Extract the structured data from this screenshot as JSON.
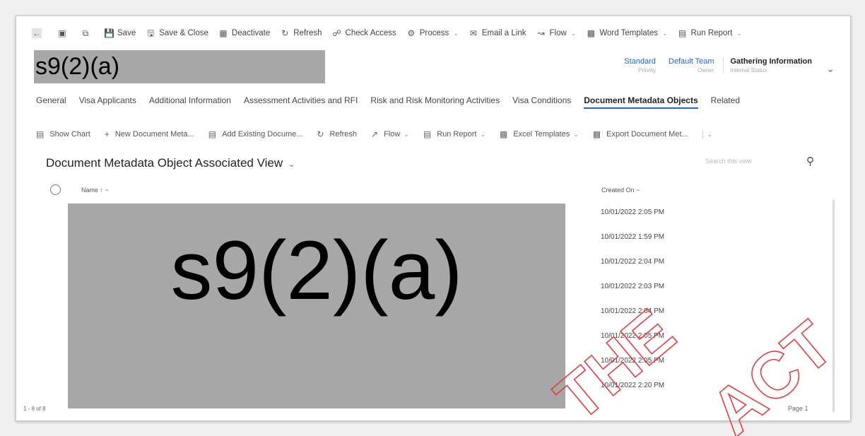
{
  "command_bar": {
    "items": [
      {
        "label": "Save",
        "icon": "save-icon"
      },
      {
        "label": "Save & Close",
        "icon": "save-close-icon"
      },
      {
        "label": "Deactivate",
        "icon": "deactivate-icon"
      },
      {
        "label": "Refresh",
        "icon": "refresh-icon"
      },
      {
        "label": "Check Access",
        "icon": "check-access-icon"
      },
      {
        "label": "Process",
        "icon": "process-icon"
      },
      {
        "label": "Email a Link",
        "icon": "email-icon"
      },
      {
        "label": "Flow",
        "icon": "flow-icon"
      },
      {
        "label": "Word Templates",
        "icon": "word-icon"
      },
      {
        "label": "Run Report",
        "icon": "report-icon"
      }
    ]
  },
  "record": {
    "title_redaction": "s9(2)(a)",
    "priority_value": "Standard",
    "priority_label": "Priority",
    "owner_value": "Default Team",
    "owner_label": "Owner",
    "status_value": "Gathering Information",
    "status_label": "Internal Status"
  },
  "tabs": [
    {
      "label": "General"
    },
    {
      "label": "Visa Applicants"
    },
    {
      "label": "Additional Information"
    },
    {
      "label": "Assessment Activities and RFI"
    },
    {
      "label": "Risk and Risk Monitoring Activities"
    },
    {
      "label": "Visa Conditions"
    },
    {
      "label": "Document Metadata Objects"
    },
    {
      "label": "Related"
    }
  ],
  "subgrid_bar": {
    "items": [
      {
        "label": "Show Chart"
      },
      {
        "label": "New Document Meta..."
      },
      {
        "label": "Add Existing Docume..."
      },
      {
        "label": "Refresh"
      },
      {
        "label": "Flow"
      },
      {
        "label": "Run Report"
      },
      {
        "label": "Excel Templates"
      },
      {
        "label": "Export Document Met..."
      }
    ]
  },
  "view": {
    "title": "Document Metadata Object Associated View",
    "search_placeholder": "Search this view",
    "col_name": "Name ↑ ~",
    "col_created": "Created On ~",
    "names_redaction": "s9(2)(a)",
    "created_on": [
      "10/01/2022 2:05 PM",
      "10/01/2022 1:59 PM",
      "10/01/2022 2:04 PM",
      "10/01/2022 2:03 PM",
      "10/01/2022 2:04 PM",
      "10/01/2022 2:05 PM",
      "10/01/2022 2:05 PM",
      "10/01/2022 2:20 PM"
    ],
    "footer": "1 - 8 of 8",
    "page_label": "Page 1"
  },
  "watermark": "RELEASED UNDER THE ACT"
}
